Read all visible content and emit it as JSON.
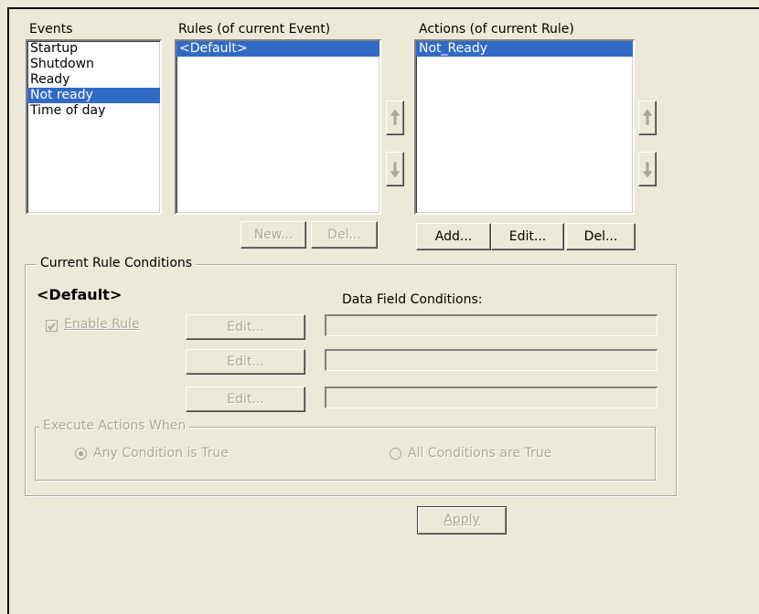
{
  "events": {
    "label": "Events",
    "items": [
      "Startup",
      "Shutdown",
      "Ready",
      "Not ready",
      "Time of day"
    ],
    "selected_index": 3
  },
  "rules": {
    "label": "Rules (of current Event)",
    "items": [
      "<Default>"
    ],
    "selected_index": 0,
    "new_label": "New...",
    "del_label": "Del..."
  },
  "actions": {
    "label": "Actions (of current Rule)",
    "items": [
      "Not_Ready"
    ],
    "selected_index": 0,
    "add_label": "Add...",
    "edit_label": "Edit...",
    "del_label": "Del..."
  },
  "conditions": {
    "group_title": "Current Rule Conditions",
    "rule_name": "<Default>",
    "data_field_label": "Data Field Conditions:",
    "enable_rule_label": "Enable Rule",
    "enable_rule_checked": true,
    "edit_labels": [
      "Edit...",
      "Edit...",
      "Edit..."
    ],
    "field_values": [
      "",
      "",
      ""
    ]
  },
  "execute": {
    "group_title": "Execute Actions When",
    "any_label": "Any Condition is True",
    "all_label": "All Conditions are True",
    "selected": "any"
  },
  "apply_label": "Apply",
  "icons": {
    "move_up": "up-arrow-icon",
    "move_down": "down-arrow-icon"
  }
}
